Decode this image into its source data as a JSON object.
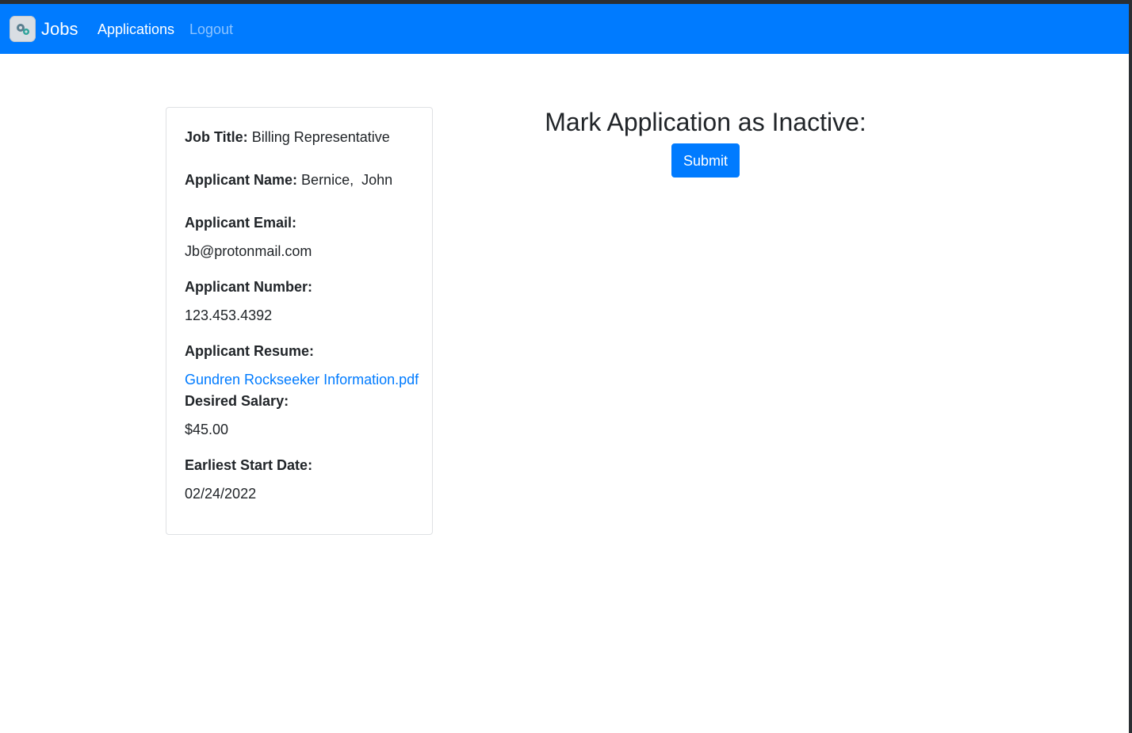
{
  "navbar": {
    "brand_label": "Jobs",
    "brand_icon": "gears-logo-icon",
    "links": [
      {
        "label": "Applications"
      },
      {
        "label": "Logout"
      }
    ]
  },
  "application": {
    "job_title_label": "Job Title:",
    "job_title": "Billing Representative",
    "applicant_name_label": "Applicant Name:",
    "applicant_name": "Bernice,  John",
    "email_label": "Applicant Email:",
    "email": "Jb@protonmail.com",
    "number_label": "Applicant Number:",
    "number": "123.453.4392",
    "resume_label": "Applicant Resume:",
    "resume_file": "Gundren Rockseeker Information.pdf",
    "salary_label": "Desired Salary:",
    "salary": "$45.00",
    "start_date_label": "Earliest Start Date:",
    "start_date": "02/24/2022"
  },
  "action": {
    "heading": "Mark Application as Inactive:",
    "submit_label": "Submit"
  },
  "colors": {
    "navbar": "#007bff",
    "link": "#007bff",
    "button": "#007bff"
  }
}
